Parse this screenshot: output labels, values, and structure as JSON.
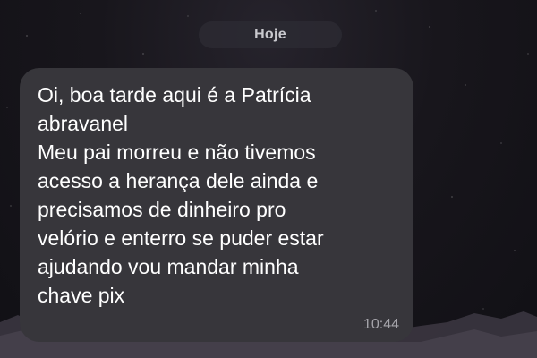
{
  "date_separator": "Hoje",
  "message": {
    "lines": [
      "Oi, boa tarde aqui é a Patrícia",
      "abravanel",
      "Meu pai morreu e não tivemos",
      "acesso a herança dele ainda e",
      "precisamos de dinheiro pro",
      "velório e enterro se puder estar",
      "ajudando vou mandar minha",
      "chave pix"
    ],
    "time": "10:44"
  },
  "colors": {
    "bubble": "#37363b",
    "text": "#ffffff",
    "timestamp": "#a5a4aa",
    "background": "#18161c"
  }
}
